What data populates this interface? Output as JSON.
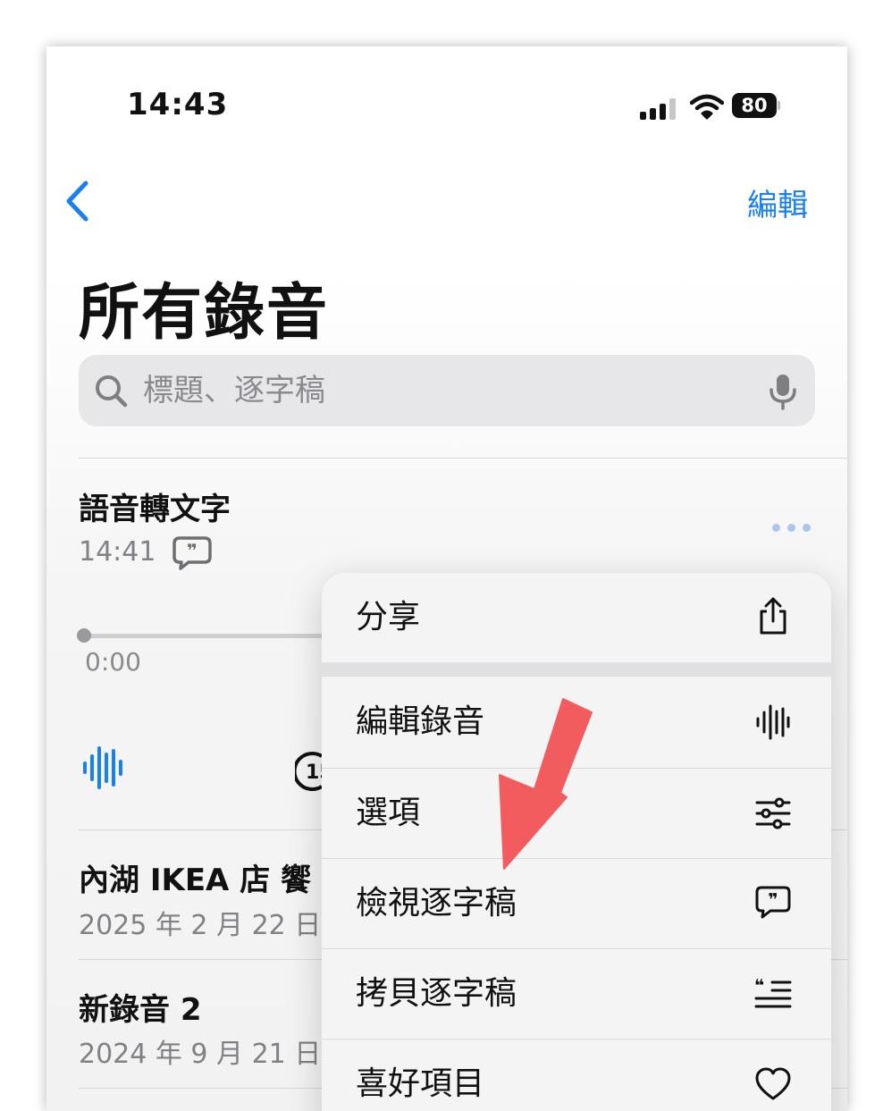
{
  "status_bar": {
    "time": "14:43",
    "battery": "80"
  },
  "nav": {
    "back_icon": "chevron-left-icon",
    "edit_label": "編輯"
  },
  "page": {
    "title": "所有錄音"
  },
  "search": {
    "placeholder": "標題、逐字稿"
  },
  "recordings": [
    {
      "title": "語音轉文字",
      "subtitle": "14:41",
      "playhead": "0:00"
    },
    {
      "title": "內湖 IKEA 店 饗",
      "subtitle": "2025 年 2 月 22 日"
    },
    {
      "title": "新錄音 2",
      "subtitle": "2024 年 9 月 21 日"
    }
  ],
  "context_menu": {
    "items": [
      {
        "label": "分享",
        "icon": "share-icon"
      },
      {
        "label": "編輯錄音",
        "icon": "waveform-icon"
      },
      {
        "label": "選項",
        "icon": "sliders-icon"
      },
      {
        "label": "檢視逐字稿",
        "icon": "transcript-icon"
      },
      {
        "label": "拷貝逐字稿",
        "icon": "copy-transcript-icon"
      },
      {
        "label": "喜好項目",
        "icon": "heart-icon"
      }
    ]
  },
  "colors": {
    "accent": "#1a7ff0",
    "annotation_arrow": "#f25c5f"
  }
}
